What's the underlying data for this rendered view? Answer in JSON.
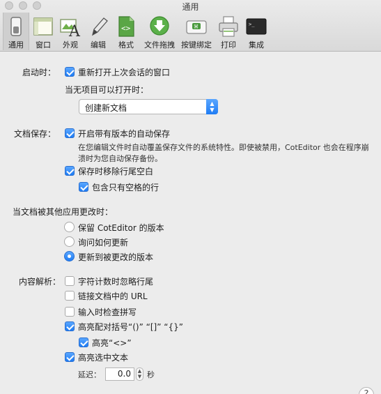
{
  "window": {
    "title": "通用"
  },
  "toolbar": {
    "items": [
      {
        "label": "通用",
        "icon": "general-switch-icon",
        "active": true
      },
      {
        "label": "窗口",
        "icon": "window-icon"
      },
      {
        "label": "外观",
        "icon": "appearance-icon"
      },
      {
        "label": "编辑",
        "icon": "pencil-icon"
      },
      {
        "label": "格式",
        "icon": "format-file-icon"
      },
      {
        "label": "文件拖拽",
        "icon": "download-arrow-icon"
      },
      {
        "label": "按键绑定",
        "icon": "keyboard-key-icon"
      },
      {
        "label": "打印",
        "icon": "printer-icon"
      },
      {
        "label": "集成",
        "icon": "terminal-icon"
      }
    ]
  },
  "startup": {
    "label": "启动时：",
    "reopen_label": "重新打开上次会话的窗口",
    "reopen_checked": true,
    "no_doc_label": "当无项目可以打开时：",
    "no_doc_selected": "创建新文档"
  },
  "save": {
    "label": "文档保存：",
    "autosave_label": "开启带有版本的自动保存",
    "autosave_checked": true,
    "autosave_desc_line1": "在您编辑文件时自动覆盖保存文件的系统特性。即使被禁用，CotEditor 也会在程序崩",
    "autosave_desc_line2": "溃时为您自动保存备份。",
    "trim_label": "保存时移除行尾空白",
    "trim_checked": true,
    "whitespace_only_label": "包含只有空格的行",
    "whitespace_only_checked": true
  },
  "external": {
    "label": "当文档被其他应用更改时：",
    "options": [
      {
        "label": "保留 CotEditor 的版本",
        "selected": false
      },
      {
        "label": "询问如何更新",
        "selected": false
      },
      {
        "label": "更新到被更改的版本",
        "selected": true
      }
    ]
  },
  "parsing": {
    "label": "内容解析：",
    "ignore_newline_label": "字符计数时忽略行尾",
    "link_url_label": "链接文档中的 URL",
    "spell_label": "输入时检查拼写",
    "braces_label": "高亮配对括号“()” “[]” “{}”",
    "angle_label": "高亮“<>”",
    "selection_label": "高亮选中文本",
    "delay_label": "延迟：",
    "delay_value": "0.0",
    "delay_unit": "秒"
  },
  "help_label": "?",
  "colors": {
    "accent": "#1f7cf4"
  }
}
